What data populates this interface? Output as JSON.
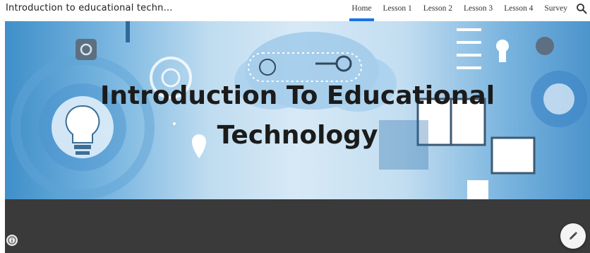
{
  "site": {
    "title": "Introduction to educational techn..."
  },
  "nav": {
    "items": [
      {
        "label": "Home",
        "active": true
      },
      {
        "label": "Lesson 1",
        "active": false
      },
      {
        "label": "Lesson 2",
        "active": false
      },
      {
        "label": "Lesson 3",
        "active": false
      },
      {
        "label": "Lesson 4",
        "active": false
      },
      {
        "label": "Survey",
        "active": false
      }
    ],
    "search_icon": "search-icon",
    "active_color": "#1a73e8"
  },
  "banner": {
    "title_line1": "Introduction To Educational",
    "title_line2": "Technology"
  },
  "footer": {
    "color": "#3a3a3a",
    "info_icon": "info-icon",
    "edit_icon": "pencil-icon"
  }
}
